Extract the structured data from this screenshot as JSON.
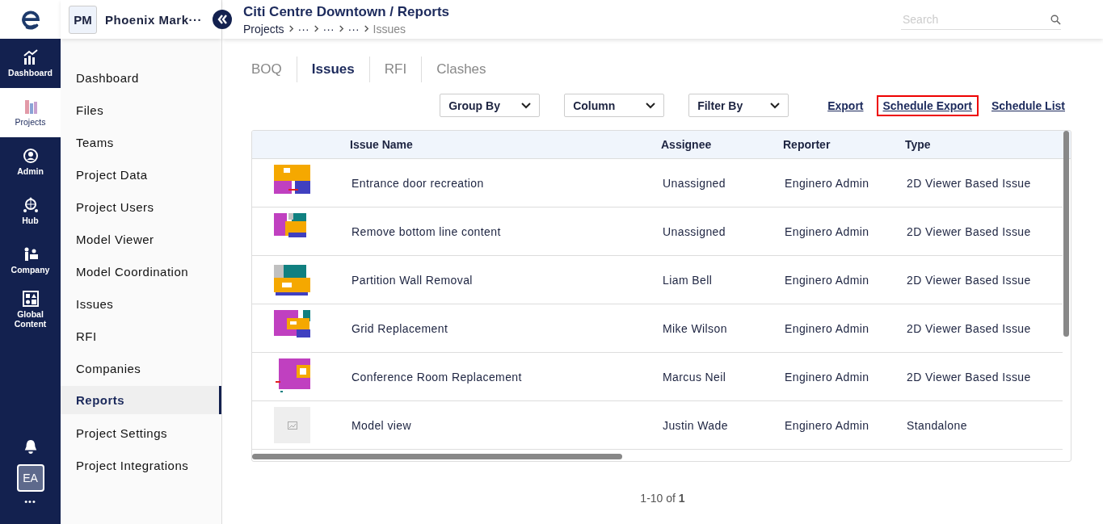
{
  "rail": {
    "items": [
      {
        "label": "Dashboard",
        "selected": false
      },
      {
        "label": "Projects",
        "selected": true
      },
      {
        "label": "Admin",
        "selected": false
      },
      {
        "label": "Hub",
        "selected": false
      },
      {
        "label": "Company",
        "selected": false
      },
      {
        "label": "Global Content",
        "selected": false
      }
    ],
    "avatar": "EA",
    "more": "•••"
  },
  "project": {
    "badge": "PM",
    "name": "Phoenix Mark···"
  },
  "nav": [
    {
      "label": "Dashboard",
      "selected": false
    },
    {
      "label": "Files",
      "selected": false
    },
    {
      "label": "Teams",
      "selected": false
    },
    {
      "label": "Project Data",
      "selected": false
    },
    {
      "label": "Project Users",
      "selected": false
    },
    {
      "label": "Model Viewer",
      "selected": false
    },
    {
      "label": "Model Coordination",
      "selected": false
    },
    {
      "label": "Issues",
      "selected": false
    },
    {
      "label": "RFI",
      "selected": false
    },
    {
      "label": "Companies",
      "selected": false
    },
    {
      "label": "Reports",
      "selected": true
    },
    {
      "label": "Project Settings",
      "selected": false
    },
    {
      "label": "Project Integrations",
      "selected": false
    }
  ],
  "header": {
    "title": "Citi Centre Downtown / Reports",
    "breadcrumb": [
      "Projects",
      "···",
      "···",
      "···",
      "Issues"
    ]
  },
  "search": {
    "placeholder": "Search"
  },
  "tabs": [
    {
      "label": "BOQ",
      "selected": false
    },
    {
      "label": "Issues",
      "selected": true
    },
    {
      "label": "RFI",
      "selected": false
    },
    {
      "label": "Clashes",
      "selected": false
    }
  ],
  "toolbar": {
    "dropdowns": [
      "Group By",
      "Column",
      "Filter By"
    ],
    "links": [
      {
        "label": "Export",
        "highlighted": false
      },
      {
        "label": "Schedule Export",
        "highlighted": true
      },
      {
        "label": "Schedule List",
        "highlighted": false
      }
    ]
  },
  "table": {
    "columns": [
      "Issue Name",
      "Assignee",
      "Reporter",
      "Type"
    ],
    "rows": [
      {
        "issue_name": "Entrance door recreation",
        "assignee": "Unassigned",
        "reporter": "Enginero Admin",
        "type": "2D Viewer Based Issue"
      },
      {
        "issue_name": "Remove bottom line content",
        "assignee": "Unassigned",
        "reporter": "Enginero Admin",
        "type": "2D Viewer Based Issue"
      },
      {
        "issue_name": "Partition Wall Removal",
        "assignee": "Liam Bell",
        "reporter": "Enginero Admin",
        "type": "2D Viewer Based Issue"
      },
      {
        "issue_name": "Grid Replacement",
        "assignee": "Mike Wilson",
        "reporter": "Enginero Admin",
        "type": "2D Viewer Based Issue"
      },
      {
        "issue_name": "Conference Room Replacement",
        "assignee": "Marcus Neil",
        "reporter": "Enginero Admin",
        "type": "2D Viewer Based Issue"
      },
      {
        "thumbnail": {
          "kind": "placeholder"
        },
        "issue_name": "Model view",
        "assignee": "Justin Wade",
        "reporter": "Enginero Admin",
        "type": "Standalone"
      }
    ]
  },
  "pagination": {
    "text": "1-10 of **1**"
  }
}
